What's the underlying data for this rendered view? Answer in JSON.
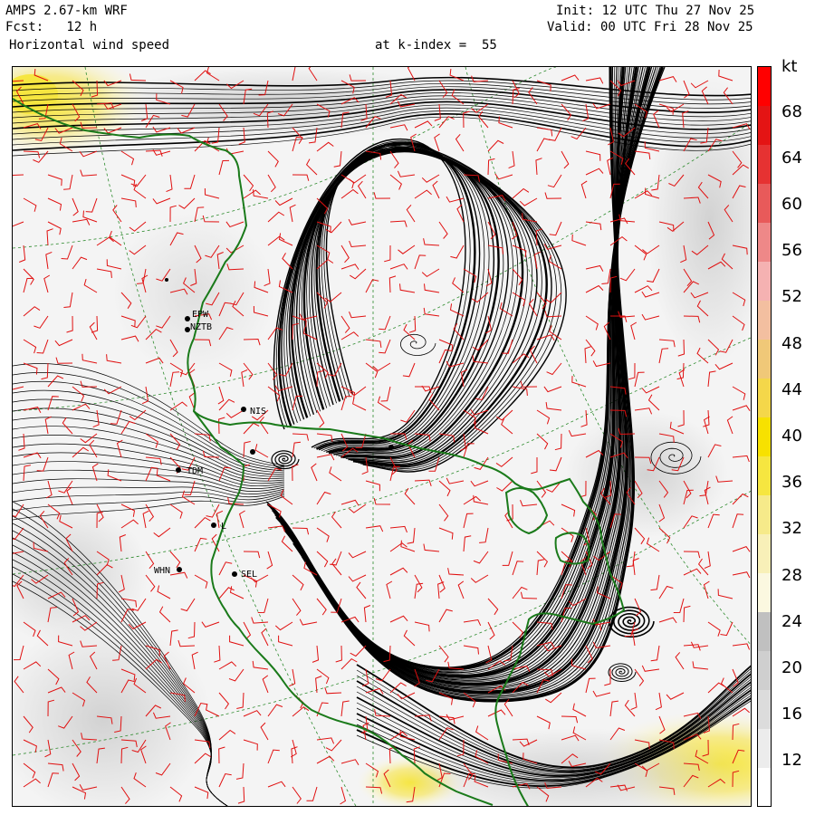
{
  "header": {
    "model": "AMPS 2.67-km WRF",
    "forecast": "Fcst:   12 h",
    "field": "Horizontal wind speed",
    "level": "at k-index =  55",
    "init": "Init: 12 UTC Thu 27 Nov 25",
    "valid": "Valid: 00 UTC Fri 28 Nov 25"
  },
  "colorbar": {
    "unit": "kt",
    "labels": [
      "68",
      "64",
      "60",
      "56",
      "52",
      "48",
      "44",
      "40",
      "36",
      "32",
      "28",
      "24",
      "20",
      "16",
      "12"
    ],
    "colors": [
      "#ffffff",
      "#ececec",
      "#dcdcdc",
      "#cfcfcf",
      "#c0c0c0",
      "#fbf8e0",
      "#f8f0b8",
      "#f6ea8a",
      "#f6e640",
      "#f7e100",
      "#f4d74a",
      "#f0c878",
      "#f3bfa0",
      "#f5b2b2",
      "#ee8888",
      "#e85a5a",
      "#e63232",
      "#e41414",
      "#ff0000"
    ]
  },
  "stations": [
    {
      "label": "EPW"
    },
    {
      "label": "NZTB"
    },
    {
      "label": "NIS"
    },
    {
      "label": "TDM"
    },
    {
      "label": "L"
    },
    {
      "label": "WHN"
    },
    {
      "label": "SEL"
    }
  ],
  "colors": {
    "coast": "#1a7a1a",
    "barb": "#e01010",
    "grid": "#2e8b2e",
    "streamline": "#000000"
  }
}
